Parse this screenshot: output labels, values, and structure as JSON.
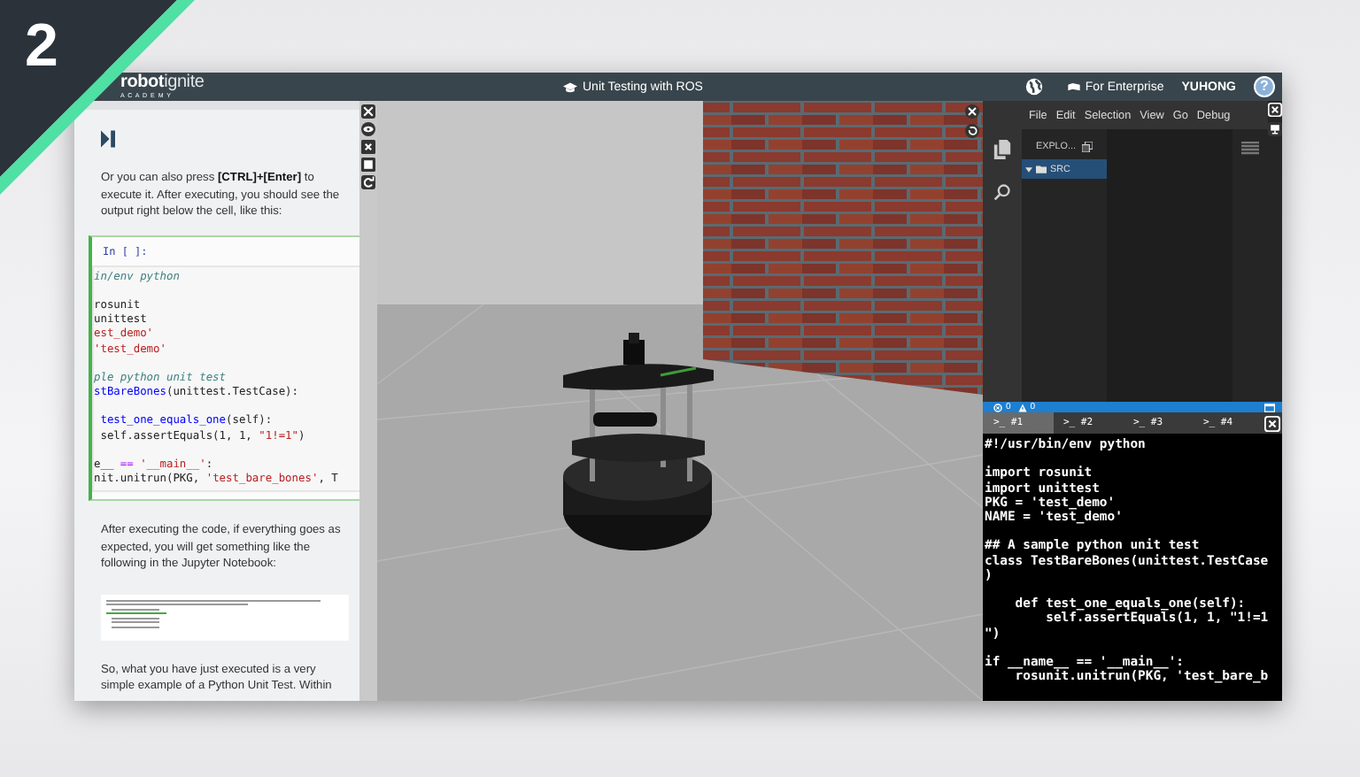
{
  "step_badge": {
    "number": "2"
  },
  "header": {
    "logo_bold": "robot",
    "logo_light": "ignite",
    "logo_subtitle": "A C A D E M Y",
    "course_title": "Unit Testing with ROS",
    "enterprise_link": "For Enterprise",
    "user_name": "YUHONG",
    "help_label": "?"
  },
  "notebook": {
    "intro": "Or you can also press **[CTRL]+[Enter]** to execute it. After executing, you should see the output right below the cell, like this:",
    "code_cell": {
      "prompt": "In [ ]:",
      "blocks": [
        [
          [
            {
              "text": "in/env python",
              "kind": "comment"
            }
          ]
        ],
        [
          [
            {
              "text": "rosunit",
              "kind": "plain"
            }
          ],
          [
            {
              "text": "unittest",
              "kind": "plain"
            }
          ],
          [
            {
              "text": "est_demo'",
              "kind": "string"
            }
          ],
          [
            {
              "text": "'test_demo'",
              "kind": "string"
            }
          ]
        ],
        [
          [
            {
              "text": "ple python unit test",
              "kind": "comment"
            }
          ],
          [
            {
              "text": "stBareBones",
              "kind": "name"
            },
            {
              "text": "(unittest.TestCase):",
              "kind": "plain"
            }
          ]
        ],
        [
          [
            {
              "text": " test_one_equals_one",
              "kind": "name"
            },
            {
              "text": "(self):",
              "kind": "plain"
            }
          ],
          [
            {
              "text": " self.assertEquals(1, 1, ",
              "kind": "plain"
            },
            {
              "text": "\"1!=1\"",
              "kind": "string"
            },
            {
              "text": ")",
              "kind": "plain"
            }
          ]
        ],
        [
          [
            {
              "text": "e__ ",
              "kind": "plain"
            },
            {
              "text": "==",
              "kind": "keyword"
            },
            {
              "text": " '__main__'",
              "kind": "string"
            },
            {
              "text": ":",
              "kind": "plain"
            }
          ],
          [
            {
              "text": "nit.unitrun(PKG, ",
              "kind": "plain"
            },
            {
              "text": "'test_bare_bones'",
              "kind": "string"
            },
            {
              "text": ", T",
              "kind": "plain"
            }
          ]
        ]
      ]
    },
    "after_code": "After executing the code, if everything goes as expected, you will get something like the following in the Jupyter Notebook:",
    "closing": "So, what you have just executed is a very simple example of a Python Unit Test. Within"
  },
  "ide": {
    "menu": [
      "File",
      "Edit",
      "Selection",
      "View",
      "Go",
      "Debug"
    ],
    "explorer_title": "EXPLO...",
    "tree": [
      {
        "label": "SRC",
        "selected": true,
        "expanded": true
      }
    ],
    "status_bar": {
      "errors": "0",
      "warnings": "0"
    },
    "terminal_tabs": [
      {
        "label": ">_ #1",
        "selected": true
      },
      {
        "label": ">_ #2",
        "selected": false
      },
      {
        "label": ">_ #3",
        "selected": false
      },
      {
        "label": ">_ #4",
        "selected": false
      }
    ],
    "terminal_blocks": [
      [
        "#!/usr/bin/env python"
      ],
      [
        "import rosunit",
        "import unittest",
        "PKG = 'test_demo'",
        "NAME = 'test_demo'"
      ],
      [
        "## A sample python unit test",
        "class TestBareBones(unittest.TestCase",
        ")"
      ],
      [
        "    def test_one_equals_one(self):",
        "        self.assertEquals(1, 1, \"1!=1",
        "\")"
      ],
      [
        "if __name__ == '__main__':",
        "    rosunit.unitrun(PKG, 'test_bare_b"
      ]
    ]
  }
}
